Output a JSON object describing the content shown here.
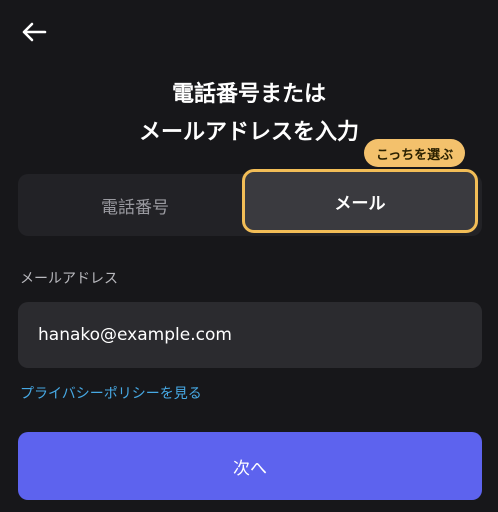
{
  "header": {
    "back_icon": "arrow-left-icon",
    "title_line1": "電話番号または",
    "title_line2": "メールアドレスを入力"
  },
  "toggle": {
    "phone_label": "電話番号",
    "email_label": "メール",
    "selected": "email",
    "hint_badge": "こっちを選ぶ"
  },
  "form": {
    "email_label": "メールアドレス",
    "email_value": "hanako@example.com",
    "privacy_link": "プライバシーポリシーを見る",
    "next_button": "次へ"
  },
  "colors": {
    "background": "#17171a",
    "accent": "#5d63ee",
    "highlight": "#f2bd57",
    "link": "#47a9e4"
  }
}
